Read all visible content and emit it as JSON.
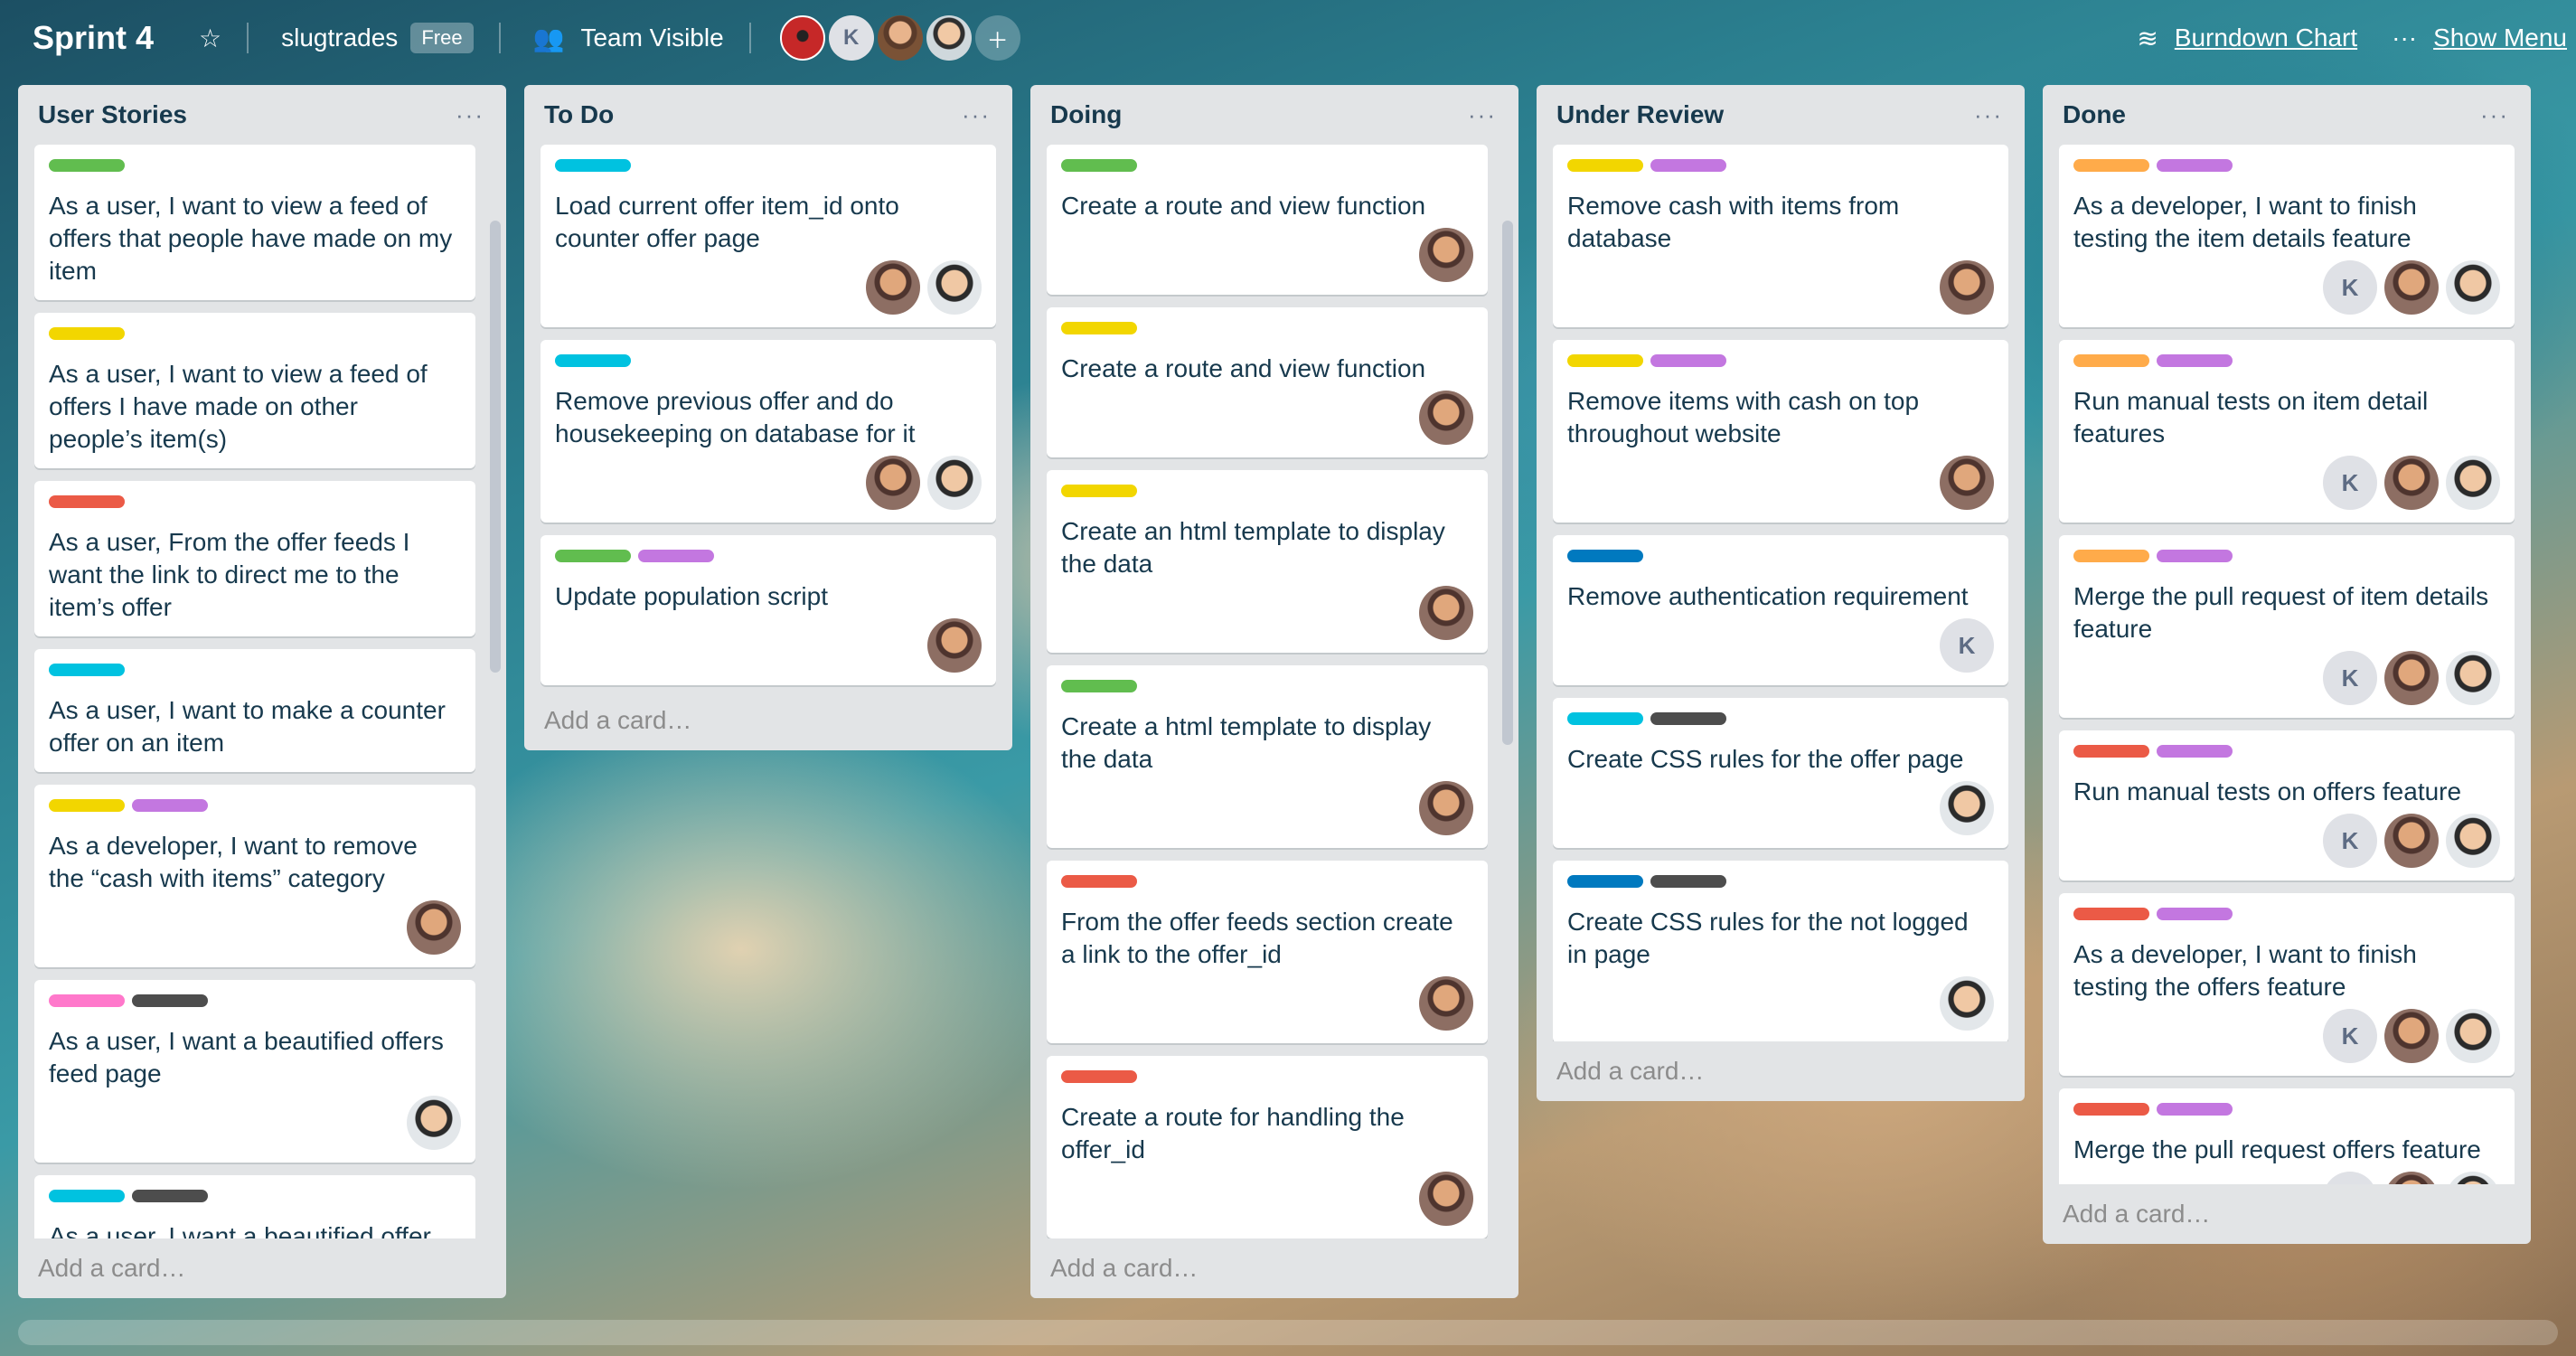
{
  "header": {
    "board_title": "Sprint 4",
    "star_icon": "star-icon",
    "team_name": "slugtrades",
    "plan_badge": "Free",
    "visibility": "Team Visible",
    "burndown": "Burndown Chart",
    "show_menu": "Show Menu",
    "members": [
      "spider",
      "K",
      "face",
      "face2"
    ]
  },
  "lists": [
    {
      "title": "User Stories",
      "add_card": "Add a card…",
      "cards": [
        {
          "labels": [
            "#61bd4f"
          ],
          "title": "As a user, I want to view a feed of offers that people have made on my item",
          "members": []
        },
        {
          "labels": [
            "#f2d600"
          ],
          "title": "As a user, I want to view a feed of offers I have made on other people’s item(s)",
          "members": []
        },
        {
          "labels": [
            "#eb5a46"
          ],
          "title": "As a user, From the offer feeds I want the link to direct me to the item’s offer",
          "members": []
        },
        {
          "labels": [
            "#00c2e0"
          ],
          "title": "As a user, I want to make a counter offer on an item",
          "members": []
        },
        {
          "labels": [
            "#f2d600",
            "#c377e0"
          ],
          "title": "As a developer, I want to remove the “cash with items” category",
          "members": [
            "face1"
          ]
        },
        {
          "labels": [
            "#ff78cb",
            "#4d4d4d"
          ],
          "title": "As a user, I want a beautified offers feed page",
          "members": [
            "face2"
          ]
        },
        {
          "labels": [
            "#00c2e0",
            "#4d4d4d"
          ],
          "title": "As a user, I want a beautified offer page",
          "members": []
        }
      ]
    },
    {
      "title": "To Do",
      "add_card": "Add a card…",
      "cards": [
        {
          "labels": [
            "#00c2e0"
          ],
          "title": "Load current offer item_id onto counter offer page",
          "members": [
            "face1",
            "face2"
          ]
        },
        {
          "labels": [
            "#00c2e0"
          ],
          "title": "Remove previous offer and do housekeeping on database for it",
          "members": [
            "face1",
            "face2"
          ]
        },
        {
          "labels": [
            "#61bd4f",
            "#c377e0"
          ],
          "title": "Update population script",
          "members": [
            "face1"
          ]
        }
      ]
    },
    {
      "title": "Doing",
      "add_card": "Add a card…",
      "cards": [
        {
          "labels": [
            "#61bd4f"
          ],
          "title": "Create a route and view function",
          "members": [
            "face1"
          ]
        },
        {
          "labels": [
            "#f2d600"
          ],
          "title": "Create a route and view function",
          "members": [
            "face1"
          ]
        },
        {
          "labels": [
            "#f2d600"
          ],
          "title": "Create an html template to display the data",
          "members": [
            "face1"
          ]
        },
        {
          "labels": [
            "#61bd4f"
          ],
          "title": "Create a html template to display the data",
          "members": [
            "face1"
          ]
        },
        {
          "labels": [
            "#eb5a46"
          ],
          "title": "From the offer feeds section create a link to the offer_id",
          "members": [
            "face1"
          ]
        },
        {
          "labels": [
            "#eb5a46"
          ],
          "title": "Create a route for handling the offer_id",
          "members": [
            "face1"
          ]
        }
      ]
    },
    {
      "title": "Under Review",
      "add_card": "Add a card…",
      "cards": [
        {
          "labels": [
            "#f2d600",
            "#c377e0"
          ],
          "title": "Remove cash with items from database",
          "members": [
            "face1"
          ]
        },
        {
          "labels": [
            "#f2d600",
            "#c377e0"
          ],
          "title": "Remove items with cash on top throughout website",
          "members": [
            "face1"
          ]
        },
        {
          "labels": [
            "#0079bf"
          ],
          "title": "Remove authentication requirement",
          "members": [
            "K"
          ]
        },
        {
          "labels": [
            "#00c2e0",
            "#4d4d4d"
          ],
          "title": "Create CSS rules for the offer page",
          "members": [
            "face2"
          ]
        },
        {
          "labels": [
            "#0079bf",
            "#4d4d4d"
          ],
          "title": "Create CSS rules for the not logged in page",
          "members": [
            "face2"
          ]
        }
      ]
    },
    {
      "title": "Done",
      "add_card": "Add a card…",
      "cards": [
        {
          "labels": [
            "#ffab4a",
            "#c377e0"
          ],
          "title": "As a developer, I want to finish testing the item details feature",
          "members": [
            "K",
            "face1",
            "face2"
          ]
        },
        {
          "labels": [
            "#ffab4a",
            "#c377e0"
          ],
          "title": "Run manual tests on item detail features",
          "members": [
            "K",
            "face1",
            "face2"
          ]
        },
        {
          "labels": [
            "#ffab4a",
            "#c377e0"
          ],
          "title": "Merge the pull request of item details feature",
          "members": [
            "K",
            "face1",
            "face2"
          ]
        },
        {
          "labels": [
            "#eb5a46",
            "#c377e0"
          ],
          "title": "Run manual tests on offers feature",
          "members": [
            "K",
            "face1",
            "face2"
          ]
        },
        {
          "labels": [
            "#eb5a46",
            "#c377e0"
          ],
          "title": "As a developer, I want to finish testing the offers feature",
          "members": [
            "K",
            "face1",
            "face2"
          ]
        },
        {
          "labels": [
            "#eb5a46",
            "#c377e0"
          ],
          "title": "Merge the pull request offers feature",
          "members": [
            "K",
            "face1",
            "face2"
          ]
        }
      ]
    }
  ]
}
